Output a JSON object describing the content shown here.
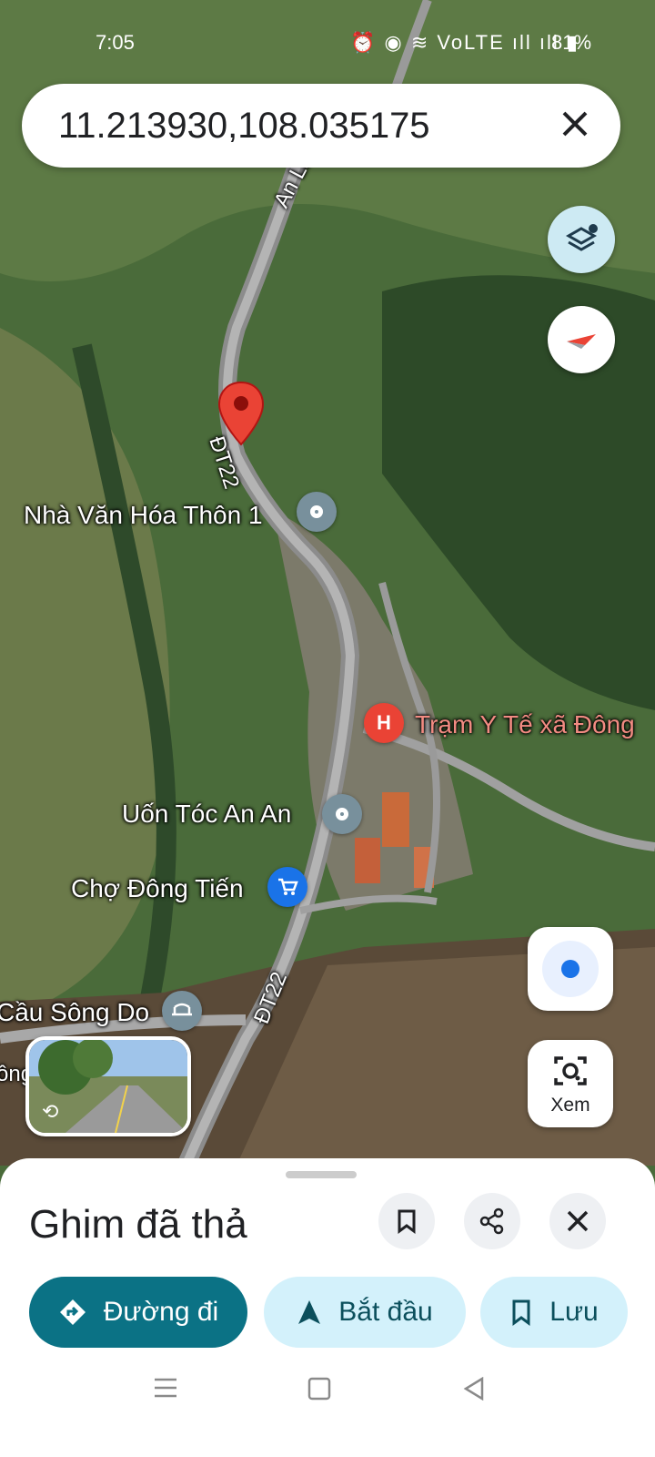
{
  "status_bar": {
    "time": "7:05",
    "icons": "⏰ ◉ ≋ VoLTE ıll ıll ▮",
    "battery": "81%"
  },
  "search": {
    "query": "11.213930,108.035175"
  },
  "map_labels": {
    "road_an_lam": "An Lâm - Đồ",
    "road_dt22_top": "ĐT22",
    "road_dt22_bottom": "ĐT22",
    "poi_nha_van_hoa": "Nhà Văn Hóa Thôn 1",
    "poi_tram_y_te": "Trạm Y Tế xã Đông",
    "poi_uon_toc": "Uốn Tóc An An",
    "poi_cho": "Chợ Đông Tiến",
    "poi_cau": "Cầu Sông Do",
    "road_left_fragment": "ông"
  },
  "explore_button": {
    "label": "Xem"
  },
  "bottom_sheet": {
    "title": "Ghim đã thả",
    "directions_label": "Đường đi",
    "start_label": "Bắt đầu",
    "save_label": "Lưu"
  },
  "colors": {
    "teal": "#0b7285",
    "light_blue": "#d3f1fb",
    "pin_red": "#ea4335",
    "poi_gray": "#78909c",
    "poi_blue": "#1a73e8"
  }
}
